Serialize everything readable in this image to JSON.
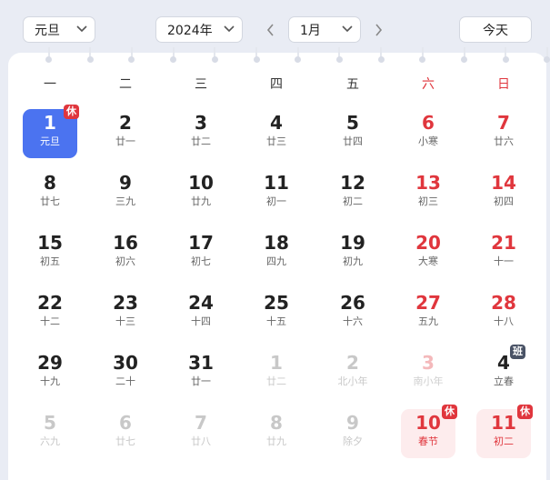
{
  "toolbar": {
    "holiday_select": "元旦",
    "year_select": "2024年",
    "month_select": "1月",
    "today_label": "今天"
  },
  "weekdays": [
    "一",
    "二",
    "三",
    "四",
    "五",
    "六",
    "日"
  ],
  "days": [
    {
      "num": "1",
      "lunar": "元旦",
      "state": "selected",
      "badge": "休"
    },
    {
      "num": "2",
      "lunar": "廿一"
    },
    {
      "num": "3",
      "lunar": "廿二"
    },
    {
      "num": "4",
      "lunar": "廿三"
    },
    {
      "num": "5",
      "lunar": "廿四"
    },
    {
      "num": "6",
      "lunar": "小寒",
      "weekend": true
    },
    {
      "num": "7",
      "lunar": "廿六",
      "weekend": true
    },
    {
      "num": "8",
      "lunar": "廿七"
    },
    {
      "num": "9",
      "lunar": "三九"
    },
    {
      "num": "10",
      "lunar": "廿九"
    },
    {
      "num": "11",
      "lunar": "初一"
    },
    {
      "num": "12",
      "lunar": "初二"
    },
    {
      "num": "13",
      "lunar": "初三",
      "weekend": true
    },
    {
      "num": "14",
      "lunar": "初四",
      "weekend": true
    },
    {
      "num": "15",
      "lunar": "初五"
    },
    {
      "num": "16",
      "lunar": "初六"
    },
    {
      "num": "17",
      "lunar": "初七"
    },
    {
      "num": "18",
      "lunar": "四九"
    },
    {
      "num": "19",
      "lunar": "初九"
    },
    {
      "num": "20",
      "lunar": "大寒",
      "weekend": true
    },
    {
      "num": "21",
      "lunar": "十一",
      "weekend": true
    },
    {
      "num": "22",
      "lunar": "十二"
    },
    {
      "num": "23",
      "lunar": "十三"
    },
    {
      "num": "24",
      "lunar": "十四"
    },
    {
      "num": "25",
      "lunar": "十五"
    },
    {
      "num": "26",
      "lunar": "十六"
    },
    {
      "num": "27",
      "lunar": "五九",
      "weekend": true
    },
    {
      "num": "28",
      "lunar": "十八",
      "weekend": true
    },
    {
      "num": "29",
      "lunar": "十九"
    },
    {
      "num": "30",
      "lunar": "二十"
    },
    {
      "num": "31",
      "lunar": "廿一"
    },
    {
      "num": "1",
      "lunar": "廿二",
      "other": true
    },
    {
      "num": "2",
      "lunar": "北小年",
      "other": true
    },
    {
      "num": "3",
      "lunar": "南小年",
      "other": true,
      "weekend": true
    },
    {
      "num": "4",
      "lunar": "立春",
      "badge": "班"
    },
    {
      "num": "5",
      "lunar": "六九",
      "other": true
    },
    {
      "num": "6",
      "lunar": "廿七",
      "other": true
    },
    {
      "num": "7",
      "lunar": "廿八",
      "other": true
    },
    {
      "num": "8",
      "lunar": "廿九",
      "other": true
    },
    {
      "num": "9",
      "lunar": "除夕",
      "other": true
    },
    {
      "num": "10",
      "lunar": "春节",
      "state": "holiday",
      "badge": "休"
    },
    {
      "num": "11",
      "lunar": "初二",
      "state": "holiday",
      "badge": "休"
    }
  ]
}
